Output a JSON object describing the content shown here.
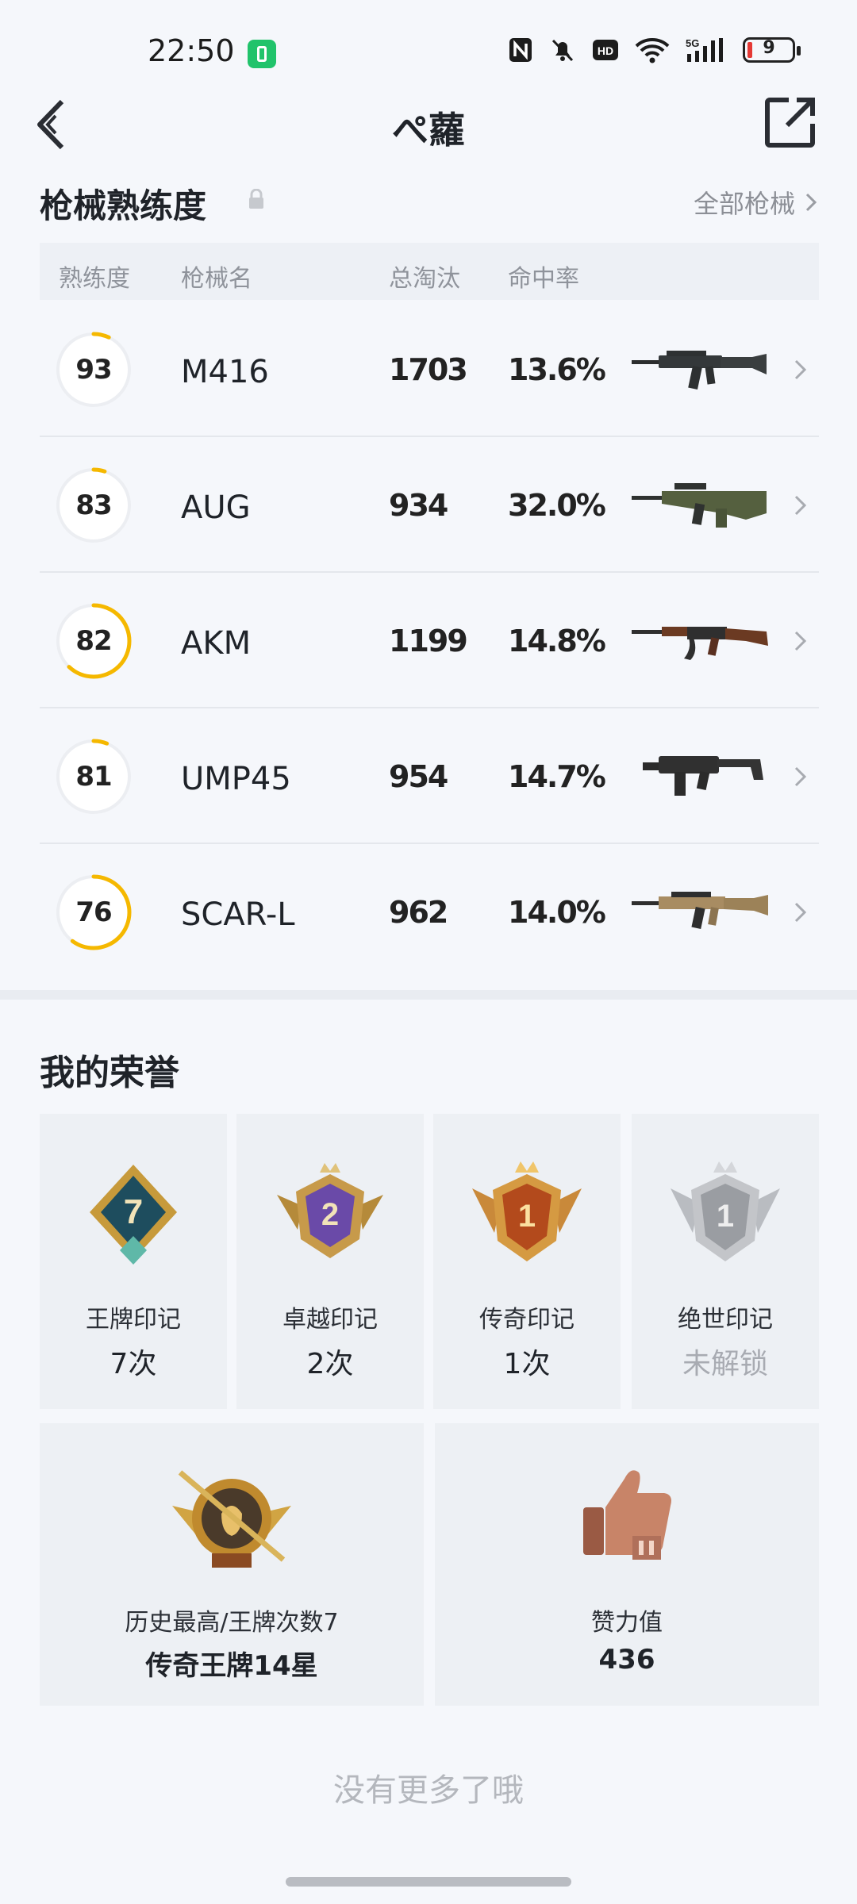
{
  "status_bar": {
    "time": "22:50",
    "battery": "9",
    "network": "5G"
  },
  "header": {
    "title": "ぺ蘿",
    "back_icon": "chevron-left-icon",
    "share_icon": "share-icon"
  },
  "weapons": {
    "title": "枪械熟练度",
    "all_link": "全部枪械",
    "columns": [
      "熟练度",
      "枪械名",
      "总淘汰",
      "命中率"
    ],
    "ring_colors": {
      "track": "#eceef2",
      "progress": "#f5b800"
    },
    "items": [
      {
        "proficiency": "93",
        "name": "M416",
        "kills": "1703",
        "hit_rate": "13.6%",
        "progress": 0.07
      },
      {
        "proficiency": "83",
        "name": "AUG",
        "kills": "934",
        "hit_rate": "32.0%",
        "progress": 0.05
      },
      {
        "proficiency": "82",
        "name": "AKM",
        "kills": "1199",
        "hit_rate": "14.8%",
        "progress": 0.62
      },
      {
        "proficiency": "81",
        "name": "UMP45",
        "kills": "954",
        "hit_rate": "14.7%",
        "progress": 0.06
      },
      {
        "proficiency": "76",
        "name": "SCAR-L",
        "kills": "962",
        "hit_rate": "14.0%",
        "progress": 0.6
      }
    ]
  },
  "honor": {
    "title": "我的荣誉",
    "badges": [
      {
        "badge_number": "7",
        "label": "王牌印记",
        "count": "7次",
        "icon": "ace-badge-icon"
      },
      {
        "badge_number": "2",
        "label": "卓越印记",
        "count": "2次",
        "icon": "excellence-badge-icon"
      },
      {
        "badge_number": "1",
        "label": "传奇印记",
        "count": "1次",
        "icon": "legend-badge-icon"
      },
      {
        "badge_number": "1",
        "label": "绝世印记",
        "count": "未解锁",
        "icon": "peerless-badge-icon",
        "locked": true
      }
    ],
    "highest": {
      "label": "历史最高/王牌次数7",
      "value": "传奇王牌14星",
      "icon": "rank-emblem-icon"
    },
    "likes": {
      "label": "赞力值",
      "value": "436",
      "icon": "thumbs-up-icon"
    }
  },
  "footer": {
    "no_more": "没有更多了哦"
  }
}
